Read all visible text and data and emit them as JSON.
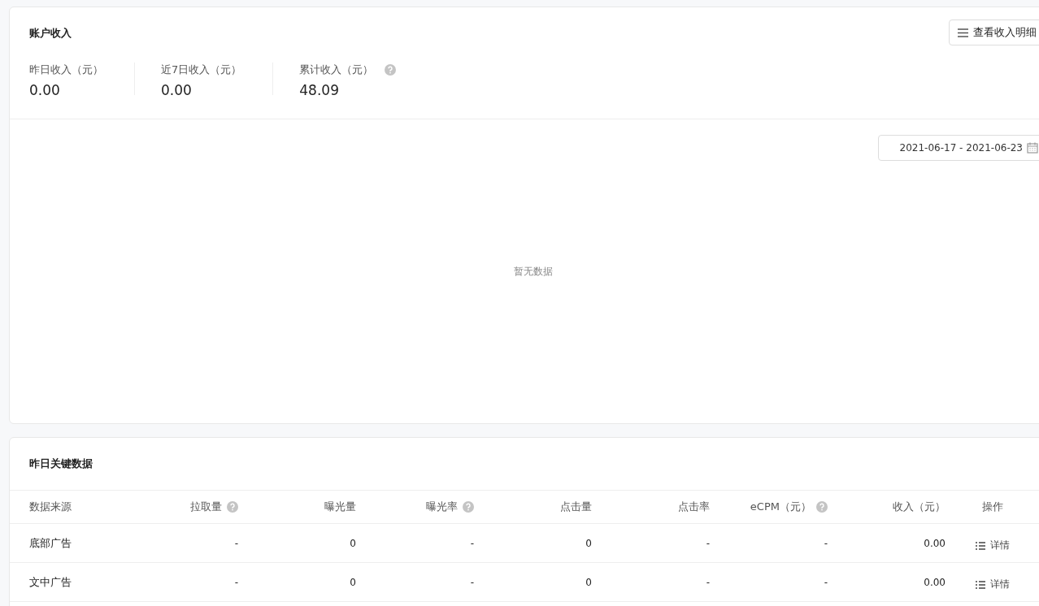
{
  "income": {
    "title": "账户收入",
    "detail_button": "查看收入明细",
    "stats": [
      {
        "label": "昨日收入（元）",
        "value": "0.00",
        "help": false
      },
      {
        "label": "近7日收入（元）",
        "value": "0.00",
        "help": false
      },
      {
        "label": "累计收入（元）",
        "value": "48.09",
        "help": true
      }
    ],
    "date_range": "2021-06-17 - 2021-06-23",
    "empty_text": "暂无数据"
  },
  "key_data": {
    "title": "昨日关键数据",
    "columns": [
      {
        "label": "数据来源",
        "help": false
      },
      {
        "label": "拉取量",
        "help": true
      },
      {
        "label": "曝光量",
        "help": false
      },
      {
        "label": "曝光率",
        "help": true
      },
      {
        "label": "点击量",
        "help": false
      },
      {
        "label": "点击率",
        "help": false
      },
      {
        "label": "eCPM（元）",
        "help": true
      },
      {
        "label": "收入（元）",
        "help": false
      },
      {
        "label": "操作",
        "help": false
      }
    ],
    "rows": [
      {
        "cells": [
          "底部广告",
          "-",
          "0",
          "-",
          "0",
          "-",
          "-",
          "0.00"
        ],
        "action": "详情"
      },
      {
        "cells": [
          "文中广告",
          "-",
          "0",
          "-",
          "0",
          "-",
          "-",
          "0.00"
        ],
        "action": "详情"
      }
    ]
  }
}
